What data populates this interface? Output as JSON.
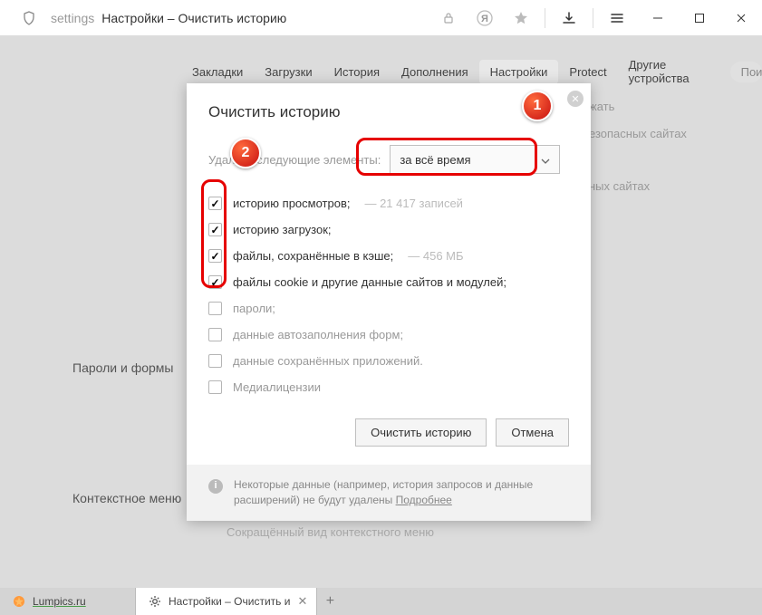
{
  "titlebar": {
    "addr_path": "settings",
    "addr_title": "Настройки – Очистить историю"
  },
  "nav": {
    "tabs": [
      "Закладки",
      "Загрузки",
      "История",
      "Дополнения",
      "Настройки",
      "Protect",
      "Другие устройства"
    ],
    "active_index": 4,
    "search_placeholder": "Пои"
  },
  "bg": {
    "line1": "жать",
    "line2": "езопасных сайтах",
    "line3": "ных сайтах",
    "side1": "Пароли и формы",
    "side2": "Контекстное меню",
    "below_modal": "Сокращённый вид контекстного меню"
  },
  "modal": {
    "title": "Очистить историю",
    "range_label": "Удалить следующие элементы:",
    "range_value": "за всё время",
    "items": [
      {
        "checked": true,
        "label": "историю просмотров;",
        "extra": "—  21 417 записей"
      },
      {
        "checked": true,
        "label": "историю загрузок;",
        "extra": ""
      },
      {
        "checked": true,
        "label": "файлы, сохранённые в кэше;",
        "extra": "—  456 МБ"
      },
      {
        "checked": true,
        "label": "файлы cookie и другие данные сайтов и модулей;",
        "extra": ""
      },
      {
        "checked": false,
        "label": "пароли;",
        "extra": ""
      },
      {
        "checked": false,
        "label": "данные автозаполнения форм;",
        "extra": ""
      },
      {
        "checked": false,
        "label": "данные сохранённых приложений.",
        "extra": ""
      },
      {
        "checked": false,
        "label": "Медиалицензии",
        "extra": ""
      }
    ],
    "clear_btn": "Очистить историю",
    "cancel_btn": "Отмена",
    "footer_text": "Некоторые данные (например, история запросов и данные расширений) не будут удалены ",
    "footer_link": "Подробнее"
  },
  "tabs": [
    {
      "title": "Lumpics.ru",
      "active": false,
      "favicon": "orange"
    },
    {
      "title": "Настройки – Очистить и",
      "active": true,
      "favicon": "gear"
    }
  ],
  "annotations": {
    "b1": "1",
    "b2": "2"
  }
}
